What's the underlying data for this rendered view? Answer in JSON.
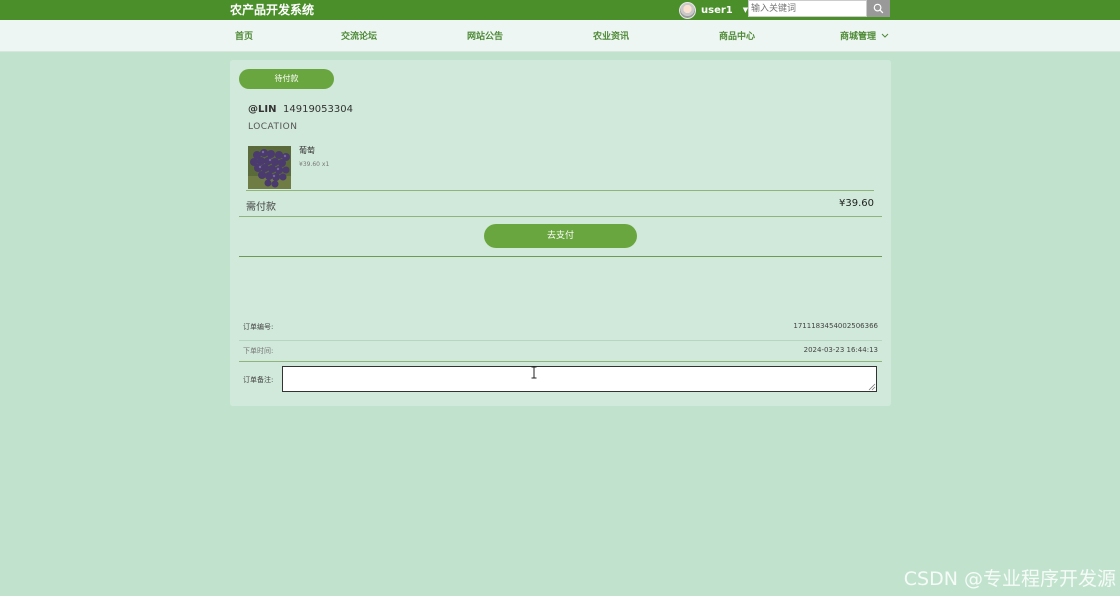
{
  "header": {
    "site_title": "农产品开发系统",
    "user_name": "user1",
    "search_placeholder": "输入关键词"
  },
  "nav": {
    "items": [
      "首页",
      "交流论坛",
      "网站公告",
      "农业资讯",
      "商品中心",
      "商城管理"
    ]
  },
  "order": {
    "status": "待付款",
    "contact_name": "@LIN",
    "contact_phone": "14919053304",
    "location": "LOCATION",
    "product_name": "葡萄",
    "product_spec": "¥39.60 x1",
    "amount_due_label": "需付款",
    "amount_due_value": "¥39.60",
    "pay_button": "去支付",
    "order_no_label": "订单编号:",
    "order_no_value": "17111834540025063​66",
    "order_time_label": "下单时间:",
    "order_time_value": "2024-03-23 16:44:13",
    "remark_label": "订单备注:"
  },
  "watermark": "CSDN @专业程序开发源",
  "colors": {
    "header_bg": "#4a8f2a",
    "page_bg": "#c1e3cd",
    "accent": "#6aa63f"
  },
  "icons": {
    "search": "search-icon",
    "caret": "chevron-down-icon"
  }
}
